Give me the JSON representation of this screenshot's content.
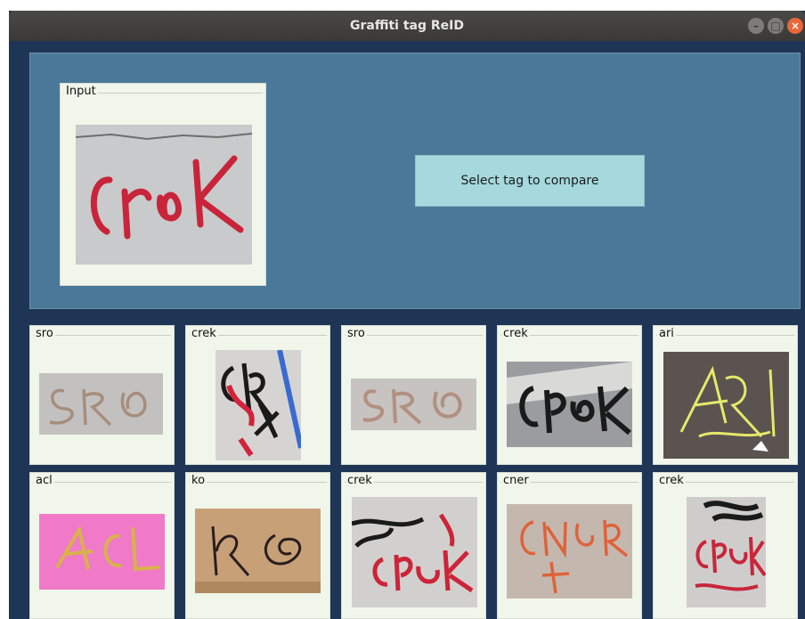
{
  "window": {
    "title": "Graffiti tag ReID"
  },
  "input_panel": {
    "label": "Input"
  },
  "compare_button": {
    "label": "Select tag to compare"
  },
  "results_row1": [
    {
      "label": "sro"
    },
    {
      "label": "crek"
    },
    {
      "label": "sro"
    },
    {
      "label": "crek"
    },
    {
      "label": "ari"
    }
  ],
  "results_row2": [
    {
      "label": "acl"
    },
    {
      "label": "ko"
    },
    {
      "label": "crek"
    },
    {
      "label": "cner"
    },
    {
      "label": "crek"
    }
  ],
  "colors": {
    "window_bg": "#1f3556",
    "panel_bg": "#4a7899",
    "frame_bg": "#f1f6ea",
    "button_bg": "#a5d9dd"
  }
}
